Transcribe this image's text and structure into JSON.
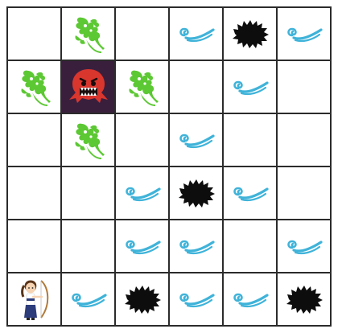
{
  "game": {
    "rows": 6,
    "cols": 6,
    "grid": [
      [
        "empty",
        "stench",
        "empty",
        "breeze",
        "pit",
        "breeze"
      ],
      [
        "stench",
        "wumpus",
        "stench",
        "empty",
        "breeze",
        "empty"
      ],
      [
        "empty",
        "stench",
        "empty",
        "breeze",
        "empty",
        "empty"
      ],
      [
        "empty",
        "empty",
        "breeze",
        "pit",
        "breeze",
        "empty"
      ],
      [
        "empty",
        "empty",
        "breeze",
        "breeze",
        "empty",
        "breeze"
      ],
      [
        "agent",
        "breeze",
        "pit",
        "breeze",
        "breeze",
        "pit"
      ]
    ],
    "icons": {
      "stench": "stench-icon",
      "breeze": "breeze-icon",
      "pit": "pit-icon",
      "wumpus": "wumpus-icon",
      "agent": "archer-agent-icon"
    },
    "colors": {
      "stench": "#5cc833",
      "breeze": "#3fb3d9",
      "pit": "#0d0d0d",
      "wumpus": "#d9362e",
      "wumpus_bg": "#3a1f3d",
      "grid_line": "#2b2b2b"
    }
  }
}
